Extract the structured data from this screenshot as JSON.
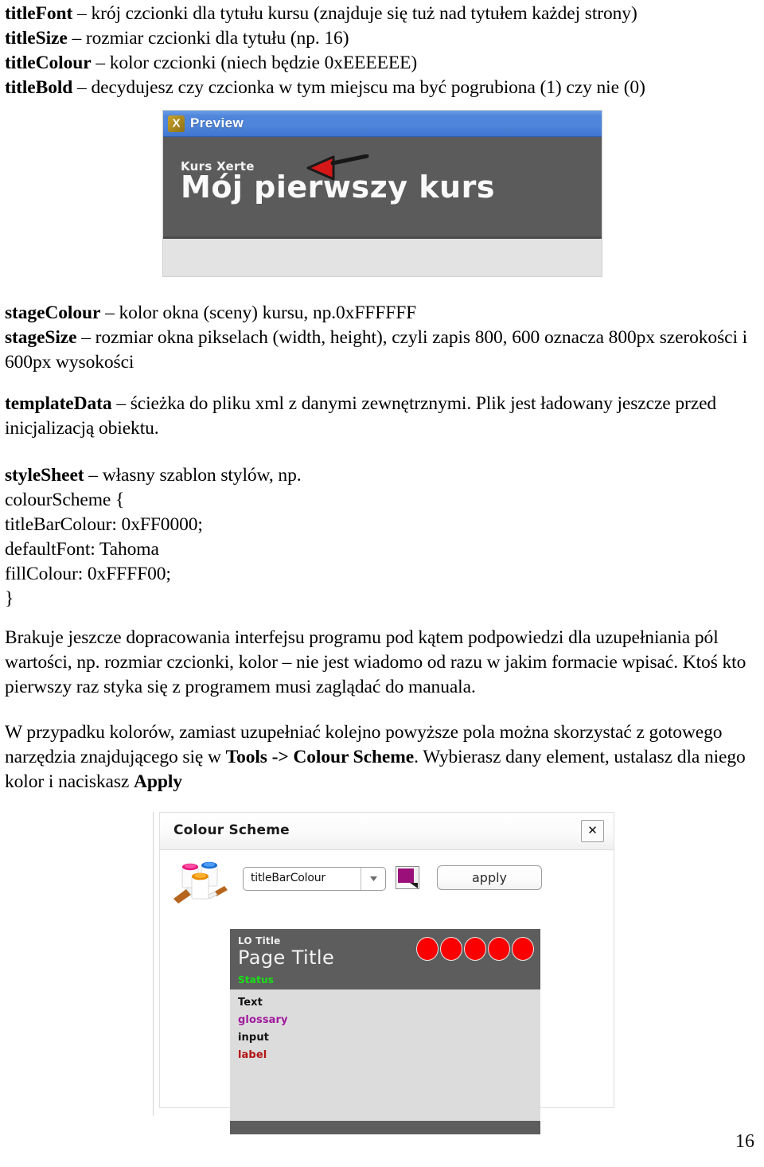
{
  "document": {
    "page_number": "16",
    "definitions": [
      {
        "term": "titleFont",
        "desc": "– krój czcionki dla tytułu kursu (znajduje się tuż nad tytułem każdej strony)"
      },
      {
        "term": "titleSize",
        "desc": "– rozmiar czcionki dla tytułu (np. 16)"
      },
      {
        "term": "titleColour",
        "desc": "– kolor czcionki (niech będzie 0xEEEEEE)"
      },
      {
        "term": "titleBold",
        "desc": "– decydujesz czy czcionka w tym miejscu ma być pogrubiona (1) czy nie (0)"
      }
    ],
    "stage": {
      "line1_term": "stageColour",
      "line1_desc": "– kolor okna (sceny) kursu, np.0xFFFFFF",
      "line2_term": "stageSize",
      "line2_desc": "– rozmiar okna pikselach (width, height), czyli zapis 800, 600 oznacza 800px szerokości i 600px wysokości"
    },
    "template": {
      "term": "templateData",
      "desc": "– ścieżka do pliku xml z danymi zewnętrznymi. Plik jest ładowany jeszcze przed inicjalizacją obiektu."
    },
    "stylesheet": {
      "term": "styleSheet",
      "desc": "– własny szablon stylów, np.",
      "code_lines": [
        "colourScheme {",
        "titleBarColour: 0xFF0000;",
        "defaultFont: Tahoma",
        "fillColour: 0xFFFF00;",
        "}"
      ]
    },
    "paragraph1": "Brakuje jeszcze dopracowania interfejsu programu pod kątem podpowiedzi dla uzupełniania pól wartości, np. rozmiar czcionki, kolor – nie jest wiadomo od razu w jakim formacie wpisać. Ktoś kto pierwszy raz styka się z programem musi zaglądać do manuala.",
    "paragraph2": {
      "part1": "W przypadku kolorów, zamiast uzupełniać kolejno powyższe pola można skorzystać z gotowego narzędzia znajdującego się w ",
      "menu_path": "Tools -> Colour Scheme",
      "part2": ". Wybierasz dany element, ustalasz dla niego kolor i naciskasz ",
      "apply_word": "Apply"
    }
  },
  "preview_window": {
    "icon": "xerte-x-icon",
    "title": "Preview",
    "stage": {
      "lo_title": "Kurs Xerte",
      "page_title": "Mój pierwszy kurs",
      "annotation_icon": "red-arrow-icon",
      "annotation_color": "#cc1111",
      "stage_bg": "#5b5b5b",
      "body_bg": "#e3e3e3",
      "titlebar_color": "#4f85da"
    }
  },
  "colour_scheme_dialog": {
    "title": "Colour Scheme",
    "close_label": "✕",
    "paint_icon": "paint-cans-icon",
    "select": {
      "value": "titleBarColour",
      "arrow_icon": "chevron-down-icon"
    },
    "swatch": {
      "color": "#9a0f7a",
      "arrow_icon": "chevron-down-icon"
    },
    "apply_label": "apply",
    "preview": {
      "lo_title": "LO Title",
      "page_title": "Page Title",
      "status": "Status",
      "status_color": "#18e018",
      "labels": [
        {
          "name": "Text",
          "color": "#111111"
        },
        {
          "name": "glossary",
          "color": "#a0199d"
        },
        {
          "name": "input",
          "color": "#111111"
        },
        {
          "name": "label",
          "color": "#b31313"
        }
      ],
      "dot_color": "#fb0000",
      "dot_count": 5,
      "header_bg": "#5d5d5d",
      "body_bg": "#dcdcdc"
    }
  }
}
